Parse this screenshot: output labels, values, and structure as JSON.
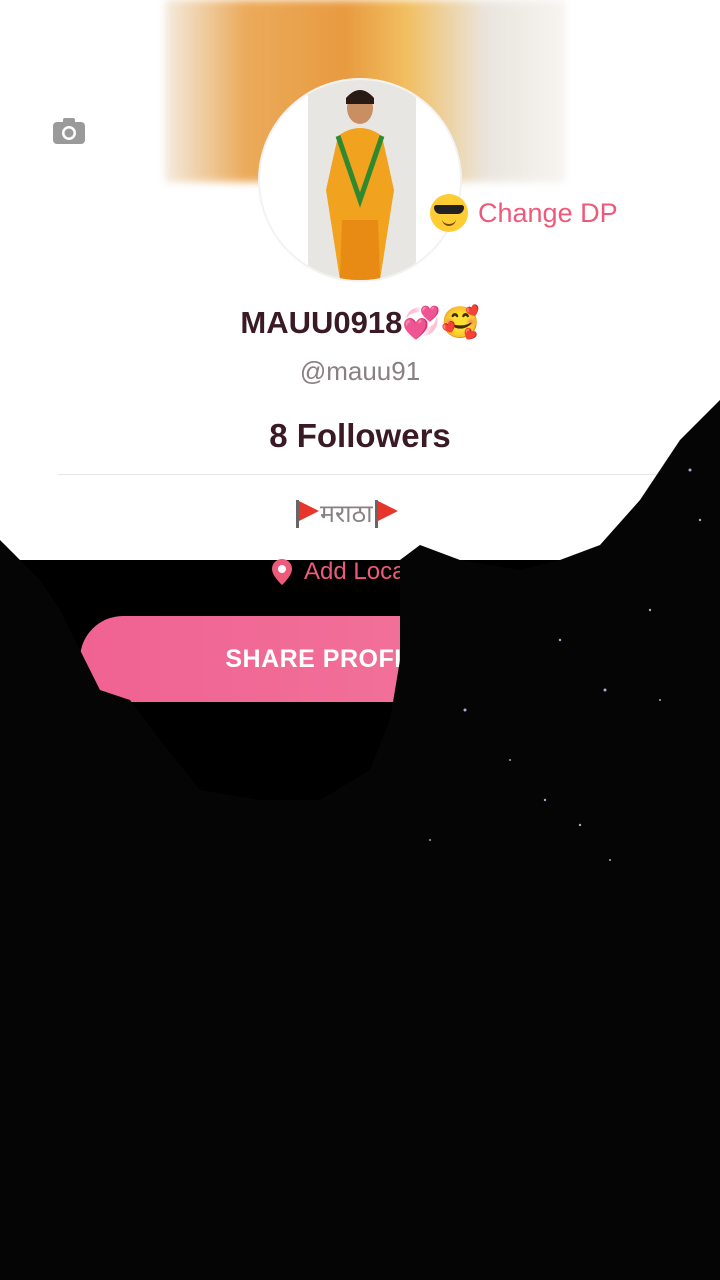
{
  "profile": {
    "username": "MAUU0918💞🥰",
    "handle": "@mauu91",
    "followers": "8 Followers",
    "bio": "मराठा",
    "change_dp_label": "Change DP",
    "location_label": "Add Location",
    "share_label": "SHARE PROFILE"
  },
  "icons": {
    "camera": "camera-icon",
    "cool_emoji": "sunglasses-emoji-icon",
    "location": "location-pin-icon",
    "flag": "flag-icon"
  },
  "colors": {
    "accent": "#ee5a7a",
    "button": "#f06292",
    "text_dark": "#3a1a24",
    "text_muted": "#8a7f84"
  }
}
